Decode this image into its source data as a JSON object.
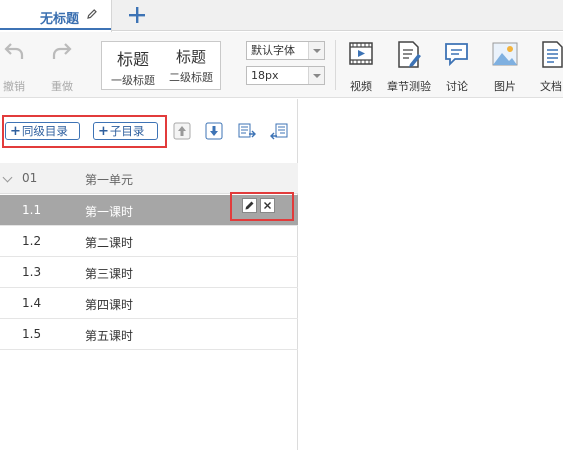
{
  "tabs": {
    "active_title": "无标题",
    "add_label": "+"
  },
  "toolbar": {
    "undo_label": "撤销",
    "redo_label": "重做",
    "heading1": {
      "big": "标题",
      "small": "一级标题"
    },
    "heading2": {
      "big": "标题",
      "small": "二级标题"
    },
    "font_family_value": "默认字体",
    "font_size_value": "18px",
    "tools": [
      {
        "label": "视频",
        "icon": "video-icon"
      },
      {
        "label": "章节测验",
        "icon": "chapter-quiz-icon"
      },
      {
        "label": "讨论",
        "icon": "discussion-icon"
      },
      {
        "label": "图片",
        "icon": "image-icon"
      },
      {
        "label": "文档",
        "icon": "document-icon"
      }
    ]
  },
  "outline": {
    "same_level_label": "同级目录",
    "child_label": "子目录",
    "unit": {
      "num": "01",
      "name": "第一单元"
    },
    "lessons": [
      {
        "num": "1.1",
        "name": "第一课时"
      },
      {
        "num": "1.2",
        "name": "第二课时"
      },
      {
        "num": "1.3",
        "name": "第三课时"
      },
      {
        "num": "1.4",
        "name": "第四课时"
      },
      {
        "num": "1.5",
        "name": "第五课时"
      }
    ]
  },
  "colors": {
    "accent": "#3d73b5",
    "highlight_box": "#e23b3b",
    "selected_row": "#a6a6a6"
  }
}
